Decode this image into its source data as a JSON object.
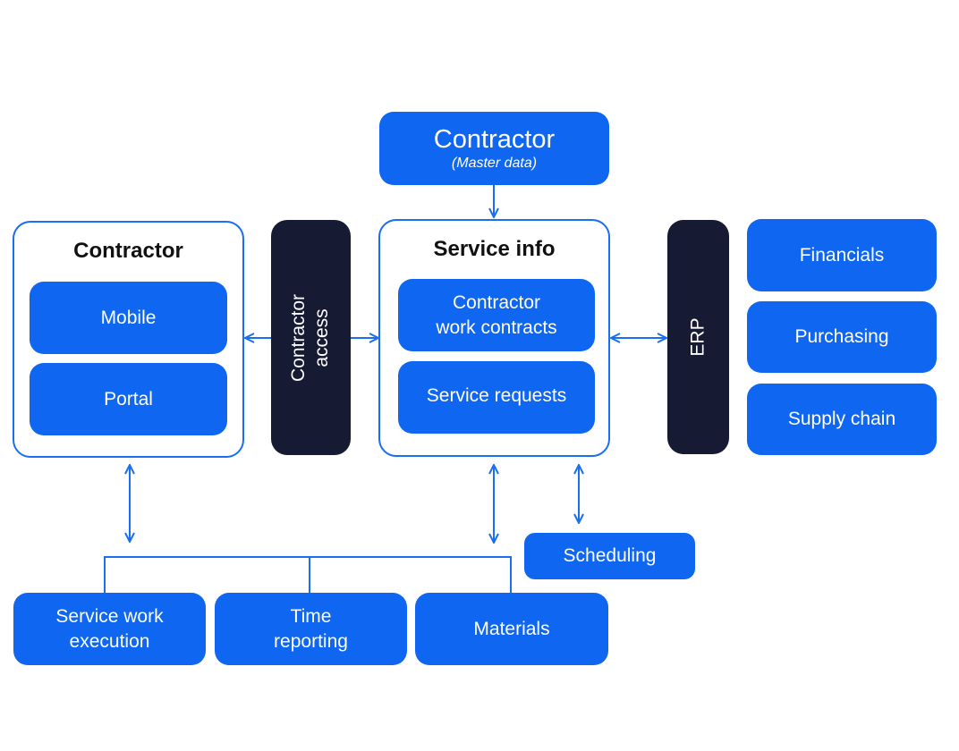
{
  "colors": {
    "primary": "#0f66f0",
    "dark": "#171a33",
    "outline": "#1a6ef0",
    "line": "#1a6ef0"
  },
  "master": {
    "title": "Contractor",
    "subtitle": "(Master data)"
  },
  "contractor_group": {
    "title": "Contractor",
    "items": [
      "Mobile",
      "Portal"
    ]
  },
  "contractor_access": {
    "line1": "Contractor",
    "line2": "access"
  },
  "service_info": {
    "title": "Service info",
    "items": [
      {
        "line1": "Contractor",
        "line2": "work contracts"
      },
      {
        "line1": "Service requests"
      }
    ]
  },
  "erp": {
    "label": "ERP"
  },
  "erp_modules": [
    "Financials",
    "Purchasing",
    "Supply chain"
  ],
  "scheduling": {
    "label": "Scheduling"
  },
  "bottom": [
    {
      "line1": "Service work",
      "line2": "execution"
    },
    {
      "line1": "Time",
      "line2": "reporting"
    },
    {
      "line1": "Materials"
    }
  ]
}
